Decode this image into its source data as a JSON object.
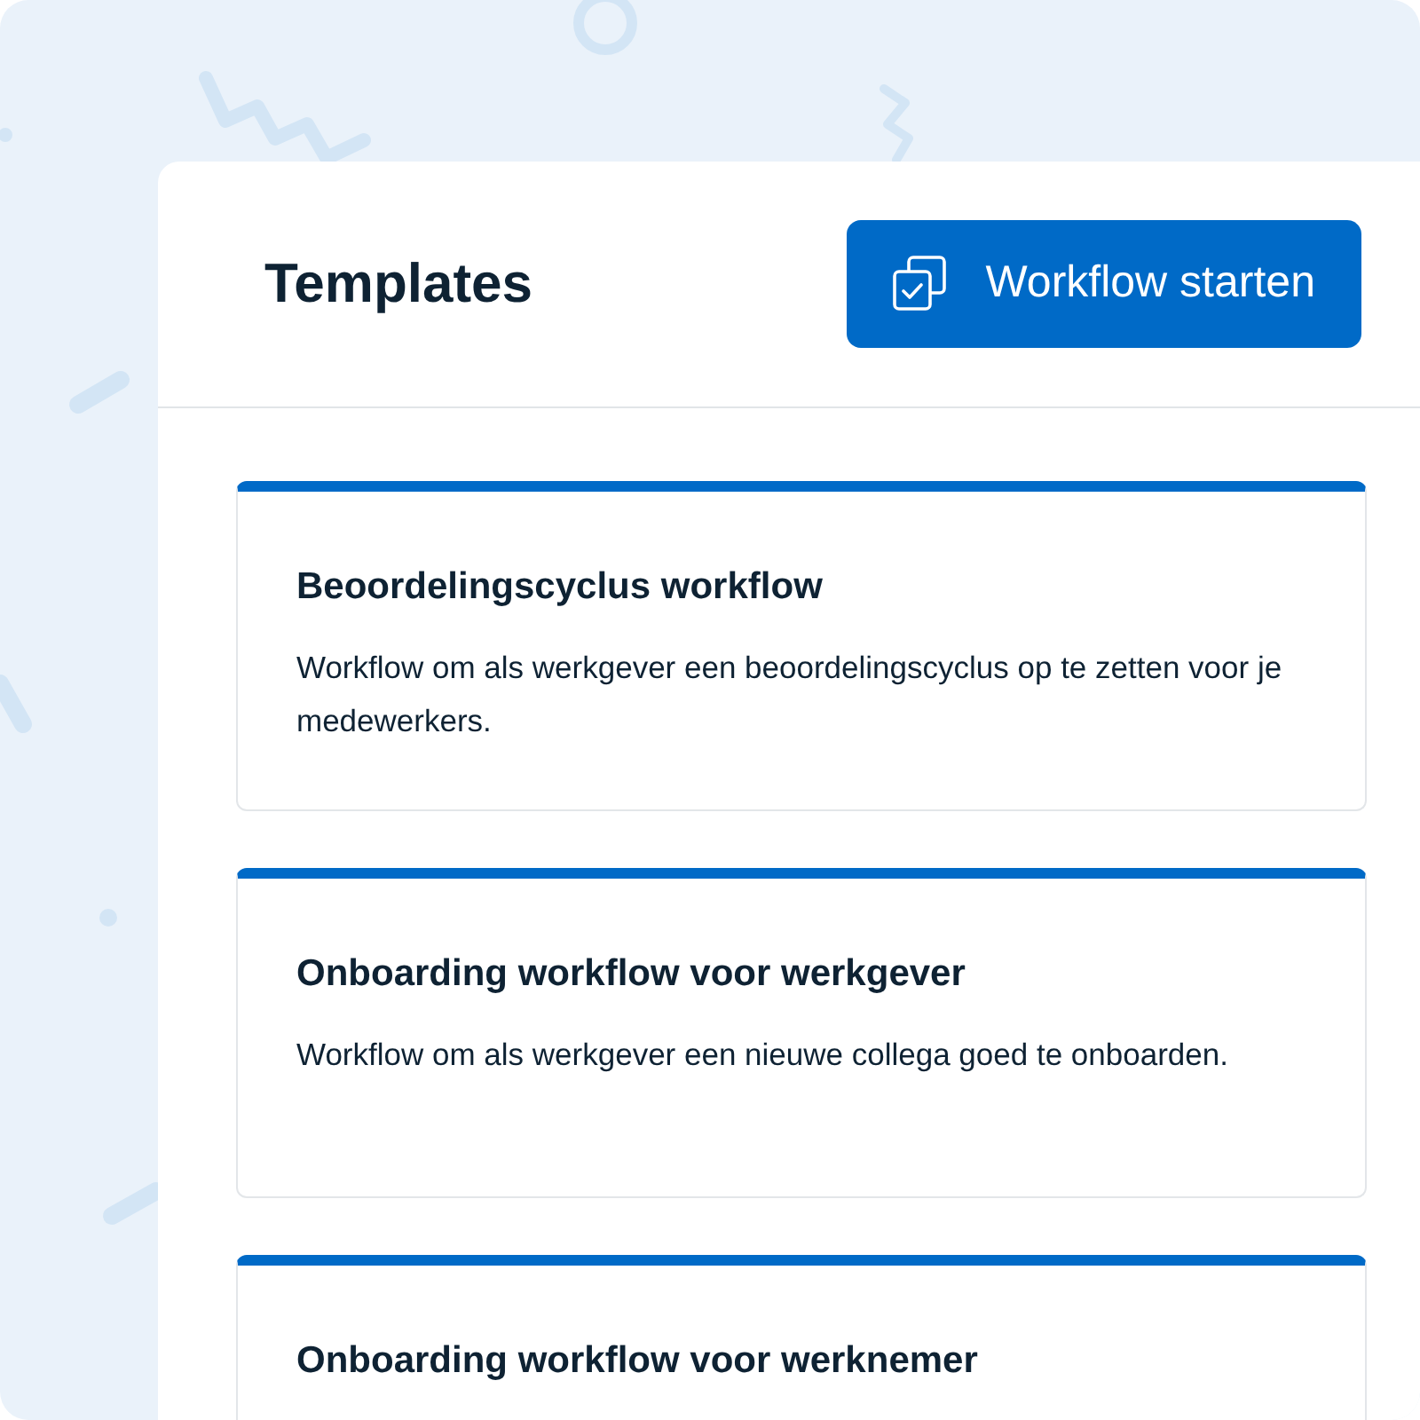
{
  "header": {
    "title": "Templates",
    "button": "Workflow starten"
  },
  "templates": [
    {
      "title": "Beoordelingscyclus workflow",
      "description": "Workflow om als werkgever een beoordelingscyclus op te zetten voor je medewerkers."
    },
    {
      "title": "Onboarding workflow voor werkgever",
      "description": "Workflow om als werkgever een nieuwe collega goed te onboarden."
    },
    {
      "title": "Onboarding workflow voor werknemer"
    }
  ]
}
